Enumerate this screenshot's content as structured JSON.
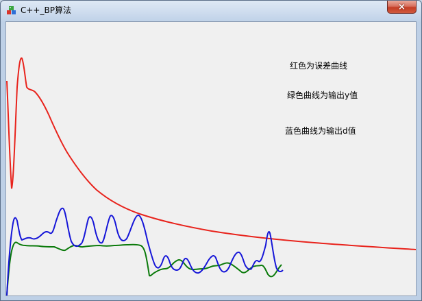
{
  "window": {
    "title": "C++_BP算法",
    "icon": "app-icon",
    "close_icon": "×"
  },
  "legend": {
    "error": "红色为误差曲线",
    "output_y": "绿色曲线为输出y值",
    "output_d": "蓝色曲线为输出d值"
  },
  "colors": {
    "error_curve": "#e8231c",
    "y_curve": "#0a7a0a",
    "d_curve": "#1616d8",
    "client_bg": "#f0f0f0"
  }
}
